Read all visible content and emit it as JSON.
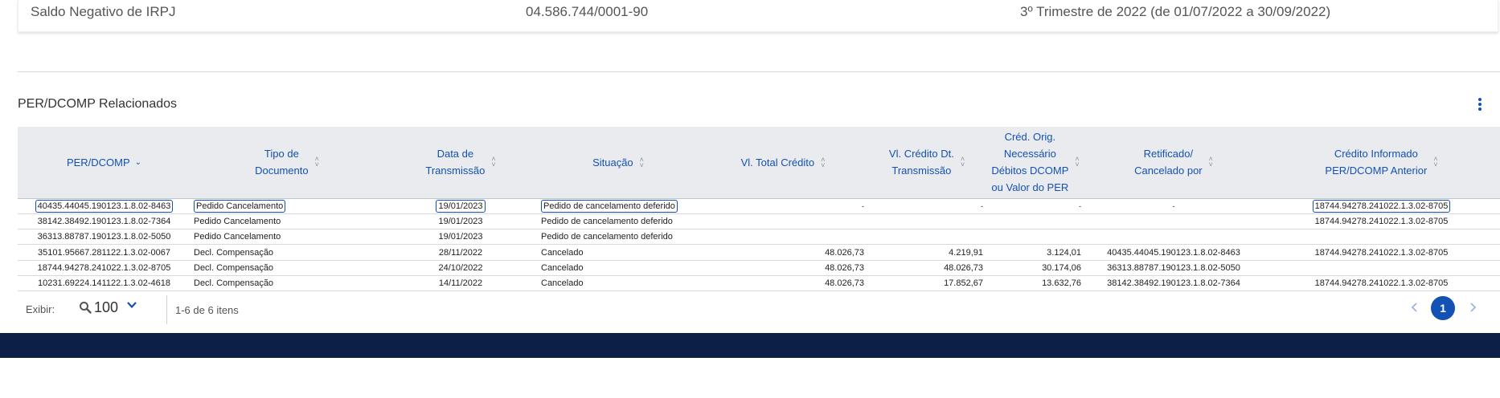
{
  "top_row": {
    "tipo": "Saldo Negativo de IRPJ",
    "cnpj": "04.586.744/0001-90",
    "periodo": "3º Trimestre de 2022 (de 01/07/2022 a 30/09/2022)"
  },
  "section": {
    "title": "PER/DCOMP Relacionados",
    "menu_icon": "kebab-vertical-icon"
  },
  "table": {
    "headers": [
      "PER/DCOMP",
      "Tipo de\nDocumento",
      "Data de\nTransmissão",
      "Situação",
      "Vl. Total Crédito",
      "Vl. Crédito Dt.\nTransmissão",
      "Créd. Orig.\nNecessário\nDébitos DCOMP\nou Valor do PER",
      "Retificado/\nCancelado por",
      "Crédito Informado\nPER/DCOMP Anterior"
    ],
    "rows": [
      [
        "40435.44045.190123.1.8.02-8463",
        "Pedido Cancelamento",
        "19/01/2023",
        "Pedido de cancelamento deferido",
        "-",
        "-",
        "-",
        "-",
        "18744.94278.241022.1.3.02-8705"
      ],
      [
        "38142.38492.190123.1.8.02-7364",
        "Pedido Cancelamento",
        "19/01/2023",
        "Pedido de cancelamento deferido",
        "",
        "",
        "",
        "",
        "18744.94278.241022.1.3.02-8705"
      ],
      [
        "36313.88787.190123.1.8.02-5050",
        "Pedido Cancelamento",
        "19/01/2023",
        "Pedido de cancelamento deferido",
        "",
        "",
        "",
        "",
        ""
      ],
      [
        "35101.95667.281122.1.3.02-0067",
        "Decl. Compensação",
        "28/11/2022",
        "Cancelado",
        "48.026,73",
        "4.219,91",
        "3.124,01",
        "40435.44045.190123.1.8.02-8463",
        "18744.94278.241022.1.3.02-8705"
      ],
      [
        "18744.94278.241022.1.3.02-8705",
        "Decl. Compensação",
        "24/10/2022",
        "Cancelado",
        "48.026,73",
        "48.026,73",
        "30.174,06",
        "36313.88787.190123.1.8.02-5050",
        ""
      ],
      [
        "10231.69224.141122.1.3.02-4618",
        "Decl. Compensação",
        "14/11/2022",
        "Cancelado",
        "48.026,73",
        "17.852,67",
        "13.632,76",
        "38142.38492.190123.1.8.02-7364",
        "18744.94278.241022.1.3.02-8705"
      ]
    ]
  },
  "pagination": {
    "exibir_label": "Exibir:",
    "per_page": "100",
    "items_label": "1-6 de 6 itens",
    "current_page": "1"
  },
  "colors": {
    "accent": "#1351b4",
    "header_bg": "#e9ebee",
    "footer_band": "#0c1f46"
  }
}
